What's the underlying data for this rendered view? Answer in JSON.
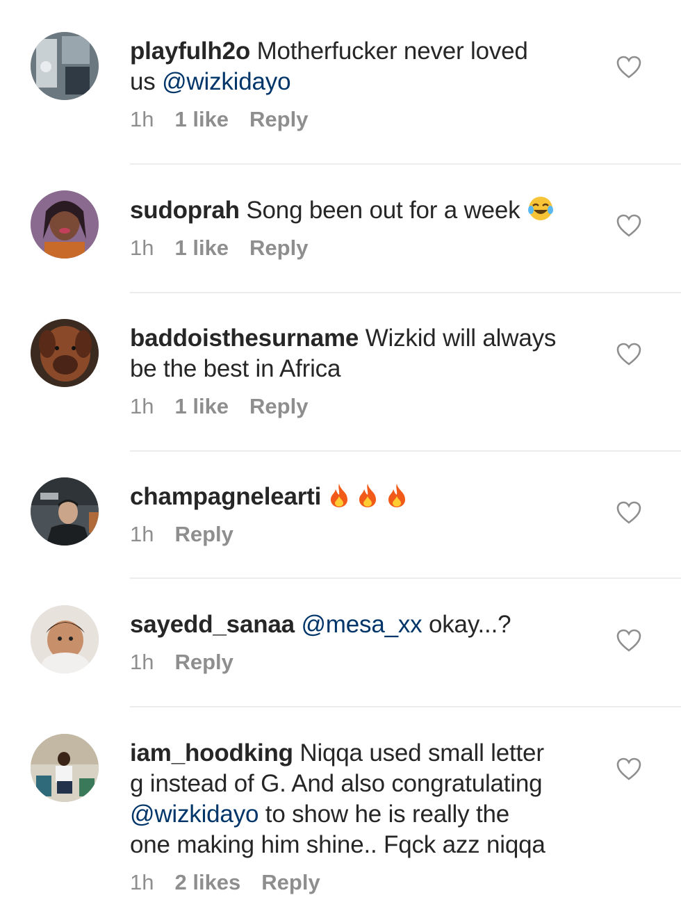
{
  "comments": [
    {
      "username": "playfulh2o",
      "text_parts": [
        "Motherfucker never loved",
        "us "
      ],
      "mention": "@wizkidayo",
      "time": "1h",
      "likes": "1 like",
      "reply": "Reply",
      "avatar_icon": "avatar-photo-indoor"
    },
    {
      "username": "sudoprah",
      "text": "Song been out for a week",
      "emoji": "crying-laughing-emoji",
      "time": "1h",
      "likes": "1 like",
      "reply": "Reply",
      "avatar_icon": "avatar-photo-woman"
    },
    {
      "username": "baddoisthesurname",
      "text_parts": [
        "Wizkid will always",
        "be the best in Africa"
      ],
      "time": "1h",
      "likes": "1 like",
      "reply": "Reply",
      "avatar_icon": "avatar-photo-dog"
    },
    {
      "username": "champagnelearti",
      "emoji": "fire-emoji",
      "emoji_count": 3,
      "time": "1h",
      "reply": "Reply",
      "avatar_icon": "avatar-photo-man"
    },
    {
      "username": "sayedd_sanaa",
      "mention": "@mesa_xx",
      "text": "okay...?",
      "time": "1h",
      "reply": "Reply",
      "avatar_icon": "avatar-photo-child"
    },
    {
      "username": "iam_hoodking",
      "text_parts": [
        "Niqqa used small letter",
        "g instead of G. And also congratulating",
        " to show he is really the",
        "one making him shine.. Fqck azz niqqa"
      ],
      "mention": "@wizkidayo",
      "time": "1h",
      "likes": "2 likes",
      "reply": "Reply",
      "avatar_icon": "avatar-photo-man-seated"
    }
  ],
  "colors": {
    "text": "#262626",
    "meta": "#8e8e8e",
    "mention": "#003569",
    "divider": "#ececec"
  },
  "icons": {
    "like": "heart-outline-icon"
  }
}
